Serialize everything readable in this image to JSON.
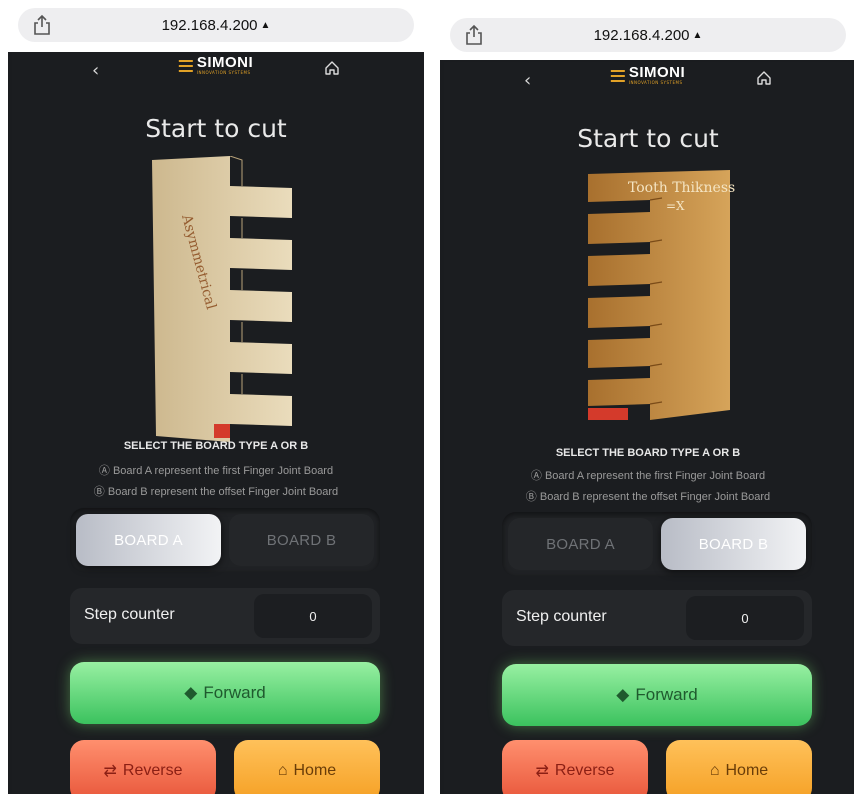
{
  "screens": [
    {
      "url": "192.168.4.200",
      "brand": {
        "name": "SIMONI",
        "tagline": "INNOVATION SYSTEMS"
      },
      "title": "Start to cut",
      "board_label": "Asymmetrical",
      "select_title": "SELECT THE BOARD TYPE A OR B",
      "note_a": "Board A represent the first Finger Joint Board",
      "note_b": "Board B represent the offset Finger Joint Board",
      "board_a_label": "BOARD A",
      "board_b_label": "BOARD B",
      "selected_board": "A",
      "step_counter_label": "Step counter",
      "step_counter_value": "0",
      "forward_label": "Forward",
      "reverse_label": "Reverse",
      "home_label": "Home"
    },
    {
      "url": "192.168.4.200",
      "brand": {
        "name": "SIMONI",
        "tagline": "INNOVATION SYSTEMS"
      },
      "title": "Start to cut",
      "board_label": "Tooth Thikness",
      "board_formula": "=X",
      "select_title": "SELECT THE BOARD TYPE A OR B",
      "note_a": "Board A represent the first Finger Joint Board",
      "note_b": "Board B represent the offset Finger Joint Board",
      "board_a_label": "BOARD A",
      "board_b_label": "BOARD B",
      "selected_board": "B",
      "step_counter_label": "Step counter",
      "step_counter_value": "0",
      "forward_label": "Forward",
      "reverse_label": "Reverse",
      "home_label": "Home"
    }
  ],
  "colors": {
    "accent": "#e2a227",
    "forward": "#3bc25e",
    "reverse": "#e8563a",
    "home": "#f5a024",
    "background": "#1b1d20"
  }
}
